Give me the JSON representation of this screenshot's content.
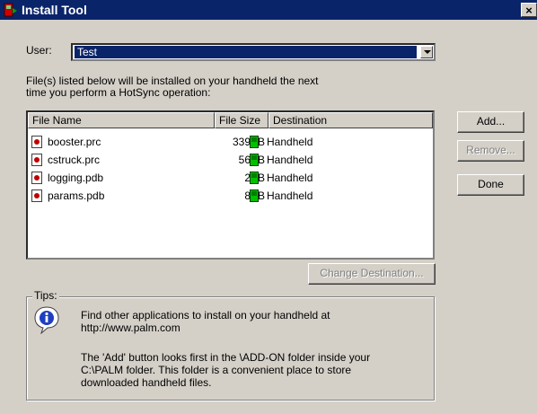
{
  "window": {
    "title": "Install Tool",
    "close_glyph": "×"
  },
  "user": {
    "label": "User:",
    "value": "Test"
  },
  "instructions": "File(s) listed below will be installed on your handheld the next\ntime you perform a HotSync operation:",
  "list": {
    "columns": [
      "File Name",
      "File Size",
      "Destination"
    ],
    "rows": [
      {
        "name": "booster.prc",
        "size": "339KB",
        "destination": "Handheld"
      },
      {
        "name": "cstruck.prc",
        "size": "56KB",
        "destination": "Handheld"
      },
      {
        "name": "logging.pdb",
        "size": "2KB",
        "destination": "Handheld"
      },
      {
        "name": "params.pdb",
        "size": "8KB",
        "destination": "Handheld"
      }
    ]
  },
  "buttons": {
    "add": "Add...",
    "remove": "Remove...",
    "done": "Done",
    "change_destination": "Change Destination..."
  },
  "tips": {
    "label": "Tips:",
    "line1": "Find other applications to install on your handheld at\nhttp://www.palm.com",
    "line2": "The 'Add' button looks first in the \\ADD-ON folder inside your\nC:\\PALM folder. This folder is a convenient place to store\ndownloaded handheld files."
  },
  "icons": {
    "app": "palm-install-icon",
    "file": "file-icon",
    "destination": "handheld-icon",
    "tips": "info-icon"
  }
}
